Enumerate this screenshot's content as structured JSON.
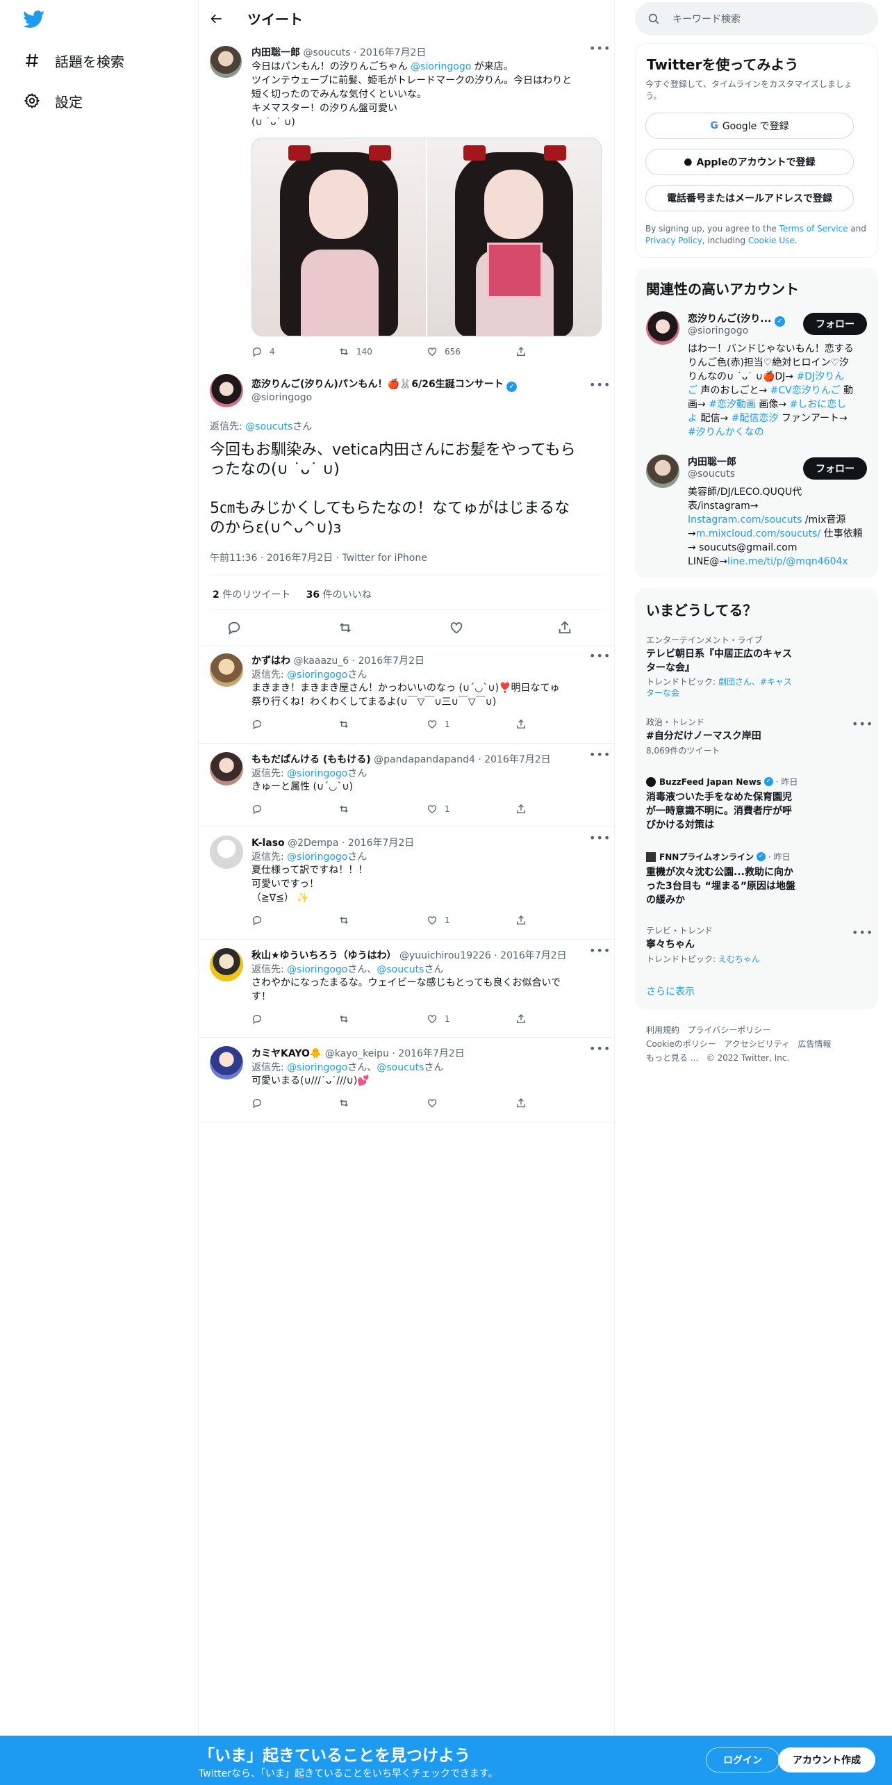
{
  "nav": {
    "explore_label": "話題を検索",
    "settings_label": "設定"
  },
  "header": {
    "title": "ツイート"
  },
  "quoted": {
    "name": "内田聡一郎",
    "handle": "@soucuts",
    "date": "2016年7月2日",
    "line1_pre": "今日はパンもん！の汐りんごちゃん ",
    "line1_mention": "@sioringogo",
    "line1_post": " が来店。",
    "line2": "ツインテウェーブに前髪、姫毛がトレードマークの汐りん。今日はわりと",
    "line3": "短く切ったのでみんな気付くといいな。",
    "line4": "キメマスター！の汐りん盤可愛い",
    "line5": "(∪ ˙ᴗ˙ ∪)",
    "replies": "4",
    "retweets": "140",
    "likes": "656"
  },
  "main": {
    "name": "恋汐りんご(汐りん)パンもん！🍎🐰6/26生誕コンサート",
    "handle": "@sioringogo",
    "reply_to_prefix": "返信先: ",
    "reply_to_handle": "@soucuts",
    "reply_to_suffix": "さん",
    "text_p1_l1": "今回もお馴染み、vetica内田さんにお髪をやってもら",
    "text_p1_l2": "ったなの(∪ ˙ᴗ˙ ∪)",
    "text_p2_l1": "5㎝もみじかくしてもらたなの！なてゅがはじまるな",
    "text_p2_l2": "のからɛ(∪^ᴗ^∪)ɜ",
    "timestamp": "午前11:36 · 2016年7月2日 · Twitter for iPhone",
    "retweet_count": "2",
    "retweet_label": " 件のリツイート",
    "like_count": "36",
    "like_label": " 件のいいね"
  },
  "replies": [
    {
      "name": "かずはわ",
      "handle": "@kaaazu_6",
      "date": "2016年7月2日",
      "to": [
        {
          "h": "@sioringogo",
          "s": "さん"
        }
      ],
      "lines": [
        "まきまき！まきまき屋さん！かっわいいのなっ (∪´◡`∪)❣️明日なてゅ",
        "祭り行くね！わくわくしてまるよ(∪￣▽￣∪三∪￣▽￣∪)"
      ],
      "likes": "1"
    },
    {
      "name": "ももだぱんける (ももける)",
      "handle": "@pandapandapand4",
      "date": "2016年7月2日",
      "to": [
        {
          "h": "@sioringogo",
          "s": "さん"
        }
      ],
      "lines": [
        "きゅーと属性 (∪´◡`∪)"
      ],
      "likes": "1"
    },
    {
      "name": "K-laso",
      "handle": "@2Dempa",
      "date": "2016年7月2日",
      "to": [
        {
          "h": "@sioringogo",
          "s": "さん"
        }
      ],
      "lines": [
        "夏仕様って訳ですね！！！",
        "可愛いですっ！",
        "（≧∇≦） ✨"
      ],
      "likes": "1"
    },
    {
      "name": "秋山★ゆういちろう（ゆうはわ）",
      "handle": "@yuuichirou19226",
      "date": "2016年7月2日",
      "to": [
        {
          "h": "@sioringogo",
          "s": "さん、"
        },
        {
          "h": "@soucuts",
          "s": "さん"
        }
      ],
      "lines": [
        "さわやかになったまるな。ウェイビーな感じもとっても良くお似合いで",
        "す！"
      ],
      "likes": "1"
    },
    {
      "name": "カミヤKAYO🐥",
      "handle": "@kayo_keipu",
      "date": "2016年7月2日",
      "to": [
        {
          "h": "@sioringogo",
          "s": "さん、"
        },
        {
          "h": "@soucuts",
          "s": "さん"
        }
      ],
      "lines": [
        "可愛いまる(∪///˙ᴗ˙///∪)💕"
      ],
      "likes": ""
    }
  ],
  "search": {
    "placeholder": "キーワード検索"
  },
  "signup": {
    "title": "Twitterを使ってみよう",
    "subtitle_l1": "今すぐ登録して、タイムラインをカスタマイズしましょ",
    "subtitle_l2": "う。",
    "google": "Google で登録",
    "apple": "Appleのアカウントで登録",
    "phone": "電話番号またはメールアドレスで登録",
    "legal_1": "By signing up, you agree to the ",
    "terms": "Terms of Service",
    "legal_2": " and",
    "privacy": "Privacy Policy",
    "legal_3": ", including ",
    "cookie": "Cookie Use",
    "legal_4": "."
  },
  "related": {
    "title": "関連性の高いアカウント",
    "follow": "フォロー",
    "accounts": [
      {
        "name": "恋汐りんご(汐り...",
        "handle": "@sioringogo"
      },
      {
        "name": "内田聡一郎",
        "handle": "@soucuts"
      }
    ],
    "bio1": [
      [
        "はわー！バンドじゃないもん！恋する"
      ],
      [
        "りんご色(赤)担当♡絶対ヒロイン♡汐"
      ],
      [
        "りんなの∪ ˙ᴗ˙ ∪🍎DJ→ ",
        "#DJ汐りん"
      ],
      [
        "ご",
        " 声のおしごと→ ",
        "#CV恋汐りんご",
        " 動"
      ],
      [
        "画→ ",
        "#恋汐動画",
        " 画像→ ",
        "#しおに恋し"
      ],
      [
        "よ",
        " 配信→ ",
        "#配信恋汐",
        " ファンアート→"
      ],
      [
        "#汐りんかくなの"
      ]
    ],
    "bio2": [
      [
        "美容師/DJ/LECO.QUQU代"
      ],
      [
        "表/instagram→"
      ],
      [
        "Instagram.com/soucuts",
        " /mix音源"
      ],
      [
        "→",
        "m.mixcloud.com/soucuts/",
        " 仕事依頼"
      ],
      [
        "→ soucuts@gmail.com"
      ],
      [
        "LINE@→",
        "line.me/ti/p/@mqn4604x"
      ]
    ]
  },
  "trends": {
    "title": "いまどうしてる？",
    "items": [
      {
        "meta": "エンターテインメント・ライブ",
        "title_l1": "テレビ朝日系『中居正広のキャス",
        "title_l2": "ターな会』",
        "sub_prefix": "トレンドトピック: ",
        "sub_l1": "劇団さん、#キャス",
        "sub_l2": "ターな会"
      },
      {
        "meta": "政治・トレンド",
        "title_l1": "#自分だけノーマスク岸田",
        "sub": "8,069件のツイート"
      },
      {
        "source": "BuzzFeed Japan News",
        "time": "· 昨日",
        "title_l1": "消毒液ついた手をなめた保育園児",
        "title_l2": "が一時意識不明に。消費者庁が呼",
        "title_l3": "びかける対策は"
      },
      {
        "source": "FNNプライムオンライン",
        "time": "· 昨日",
        "title_l1": "重機が次々沈む公園...救助に向か",
        "title_l2": "った3台目も “埋まる”原因は地盤",
        "title_l3": "の緩みか"
      },
      {
        "meta": "テレビ・トレンド",
        "title_l1": "寧々ちゃん",
        "sub_prefix": "トレンドトピック: ",
        "sub_l1": "えむちゃん"
      }
    ],
    "more": "さらに表示"
  },
  "footer": {
    "l1": [
      "利用規約",
      "プライバシーポリシー"
    ],
    "l2": [
      "Cookieのポリシー",
      "アクセシビリティ",
      "広告情報"
    ],
    "l3": [
      "もっと見る ...",
      "© 2022 Twitter, Inc."
    ]
  },
  "banner": {
    "title": "「いま」起きていることを見つけよう",
    "subtitle": "Twitterなら、「いま」起きていることをいち早くチェックできます。",
    "login": "ログイン",
    "signup": "アカウント作成"
  },
  "colors": {
    "accent": "#1d9bf0",
    "text": "#0f1419",
    "muted": "#536471",
    "border": "#eff3f4",
    "panel": "#f7f9f9"
  }
}
